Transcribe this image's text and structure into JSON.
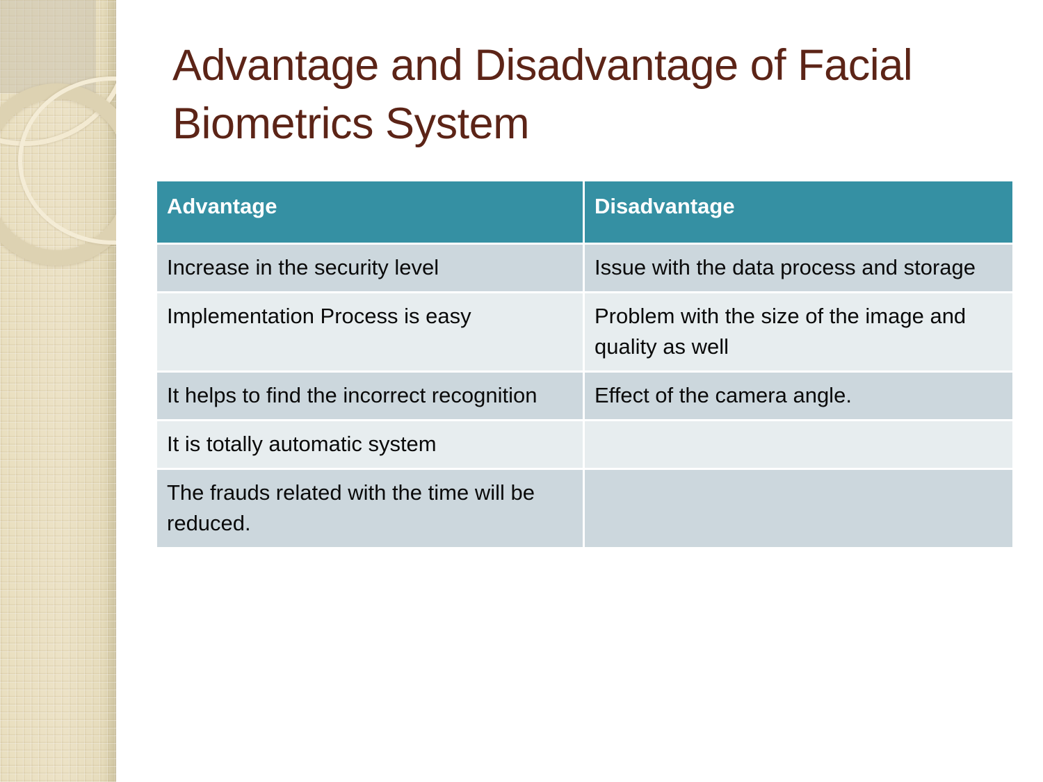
{
  "slide": {
    "title": "Advantage and Disadvantage of Facial Biometrics System",
    "title_color": "#5c2417",
    "background_color": "#ffffff"
  },
  "sidebar": {
    "name": "decorative-sidebar",
    "base_color": "#ece2c6",
    "ring_light_color": "#f3ead2",
    "ring_tan_color": "#ddd2b2"
  },
  "table": {
    "header_bg": "#3590a3",
    "header_text_color": "#ffffff",
    "row_band_dark": "#ccd7dd",
    "row_band_light": "#e7edef",
    "columns": [
      {
        "key": "advantage",
        "label": "Advantage"
      },
      {
        "key": "disadvantage",
        "label": "Disadvantage"
      }
    ],
    "rows": [
      {
        "advantage": "Increase in the security level",
        "disadvantage": " Issue with the data process and storage"
      },
      {
        "advantage": "Implementation Process is easy",
        "disadvantage": "Problem with the size of the image and quality as well"
      },
      {
        "advantage": "It helps to find the incorrect recognition",
        "disadvantage": "Effect of the camera angle."
      },
      {
        "advantage": "It is totally automatic system",
        "disadvantage": ""
      },
      {
        "advantage": "The frauds related with the time will be reduced.",
        "disadvantage": ""
      }
    ]
  }
}
